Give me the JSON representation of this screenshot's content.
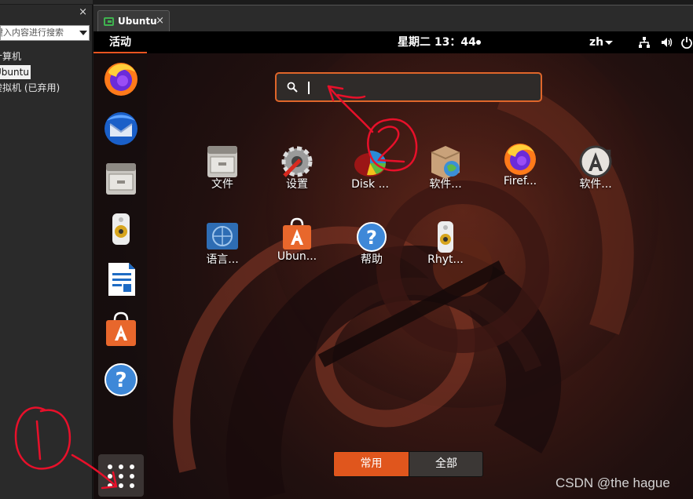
{
  "library": {
    "close_label": "×",
    "search_placeholder": "键入内容进行搜索",
    "tree": [
      "计算机",
      "Ubuntu",
      "虚拟机 (已弃用)"
    ]
  },
  "tab": {
    "title": "Ubuntu",
    "close_label": "×"
  },
  "topbar": {
    "activities": "活动",
    "clock": "星期二 13：44",
    "language": "zh",
    "tray_icons": [
      "network-icon",
      "volume-icon",
      "power-icon"
    ]
  },
  "dock": {
    "items": [
      "firefox-icon",
      "thunderbird-icon",
      "files-icon",
      "rhythmbox-icon",
      "writer-icon",
      "software-icon",
      "help-icon"
    ]
  },
  "search": {
    "value": "",
    "placeholder": ""
  },
  "apps": [
    {
      "label": "文件",
      "icon": "files-icon"
    },
    {
      "label": "设置",
      "icon": "settings-icon"
    },
    {
      "label": "Disk ...",
      "icon": "disk-usage-icon"
    },
    {
      "label": "软件...",
      "icon": "software-properties-icon"
    },
    {
      "label": "Firef...",
      "icon": "firefox-icon"
    },
    {
      "label": "软件...",
      "icon": "software-updater-icon"
    },
    {
      "label": "语言...",
      "icon": "language-support-icon"
    },
    {
      "label": "Ubun...",
      "icon": "ubuntu-software-icon"
    },
    {
      "label": "帮助",
      "icon": "help-icon"
    },
    {
      "label": "Rhyt...",
      "icon": "rhythmbox-icon"
    }
  ],
  "view_toggle": {
    "frequent": "常用",
    "all": "全部",
    "selected": "常用"
  },
  "watermark": "CSDN @the hague",
  "colors": {
    "accent": "#e95420",
    "annotation": "#e8102a"
  }
}
